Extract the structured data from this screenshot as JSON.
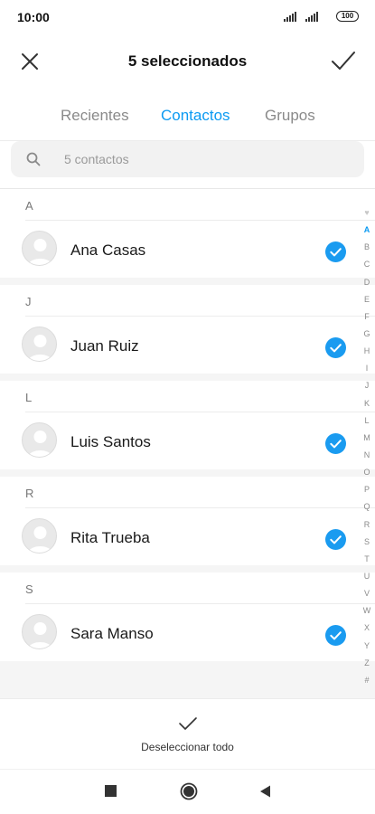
{
  "status": {
    "time": "10:00",
    "battery": "100"
  },
  "header": {
    "title": "5 seleccionados",
    "close_icon": "close-icon",
    "confirm_icon": "check-icon"
  },
  "tabs": [
    {
      "label": "Recientes",
      "active": false
    },
    {
      "label": "Contactos",
      "active": true
    },
    {
      "label": "Grupos",
      "active": false
    }
  ],
  "search": {
    "placeholder": "5 contactos",
    "icon": "search-icon"
  },
  "sections": [
    {
      "letter": "A",
      "contact": "Ana Casas",
      "selected": true
    },
    {
      "letter": "J",
      "contact": "Juan Ruiz",
      "selected": true
    },
    {
      "letter": "L",
      "contact": "Luis Santos",
      "selected": true
    },
    {
      "letter": "R",
      "contact": "Rita Trueba",
      "selected": true
    },
    {
      "letter": "S",
      "contact": "Sara Manso",
      "selected": true
    }
  ],
  "alphabet": [
    "♥",
    "A",
    "B",
    "C",
    "D",
    "E",
    "F",
    "G",
    "H",
    "I",
    "J",
    "K",
    "L",
    "M",
    "N",
    "O",
    "P",
    "Q",
    "R",
    "S",
    "T",
    "U",
    "V",
    "W",
    "X",
    "Y",
    "Z",
    "#"
  ],
  "alphabet_active": "A",
  "bottom": {
    "deselect_label": "Deseleccionar todo"
  },
  "colors": {
    "accent": "#0b9af2",
    "check_fill": "#1a9bf0"
  }
}
